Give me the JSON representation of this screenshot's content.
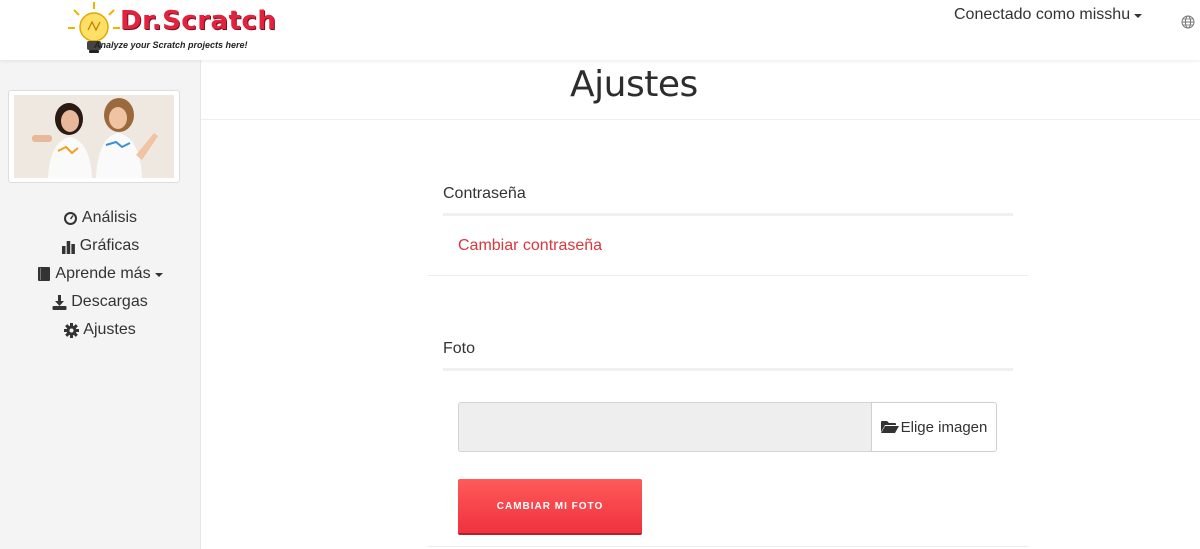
{
  "header": {
    "logo_title": "Dr.Scratch",
    "logo_subtitle": "Analyze your Scratch projects here!",
    "user_menu_label": "Conectado como misshu",
    "language_icon": "globe-icon"
  },
  "sidebar": {
    "items": [
      {
        "label": "Análisis",
        "icon": "dashboard-icon"
      },
      {
        "label": "Gráficas",
        "icon": "bar-chart-icon"
      },
      {
        "label": "Aprende más",
        "icon": "book-icon",
        "dropdown": true
      },
      {
        "label": "Descargas",
        "icon": "download-icon"
      },
      {
        "label": "Ajustes",
        "icon": "gear-icon"
      }
    ]
  },
  "main": {
    "title": "Ajustes",
    "password_section": {
      "title": "Contraseña",
      "change_link": "Cambiar contraseña"
    },
    "photo_section": {
      "title": "Foto",
      "file_value": "",
      "choose_button": "Elige imagen",
      "submit_button": "CAMBIAR MI FOTO"
    }
  },
  "colors": {
    "accent_red": "#e3233e",
    "link_red": "#d9363e",
    "button_red": "#f0323e"
  }
}
